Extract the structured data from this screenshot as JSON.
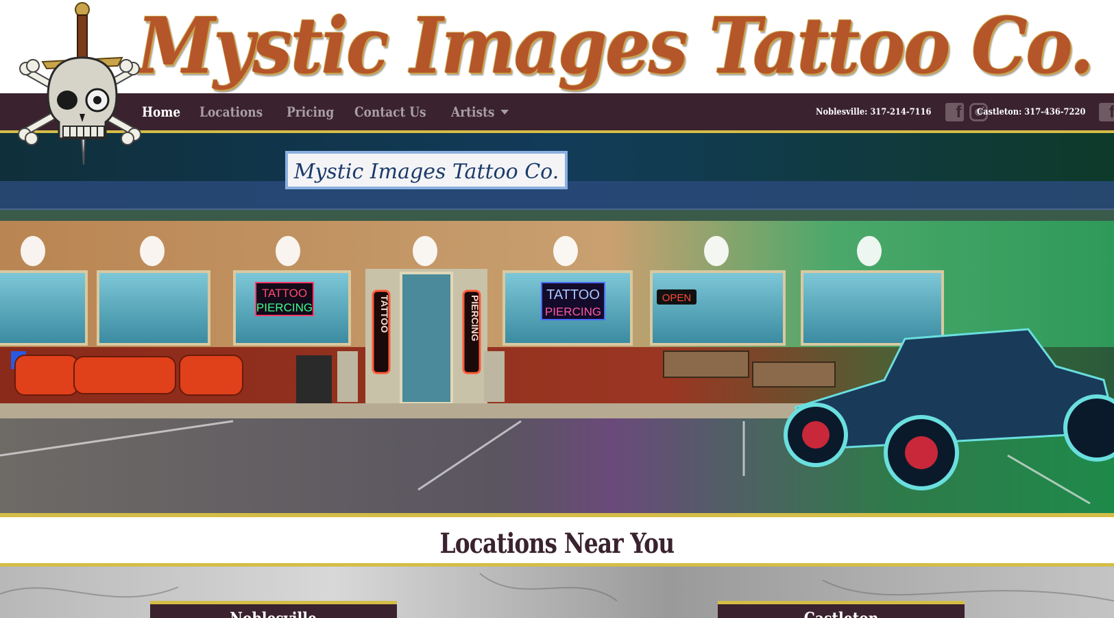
{
  "site": {
    "logo_text": "Mystic Images Tattoo Co.",
    "sign_text": "Mystic Images Tattoo Co."
  },
  "nav": {
    "items": [
      {
        "label": "Home",
        "active": true
      },
      {
        "label": "Locations",
        "active": false
      },
      {
        "label": "Pricing",
        "active": false
      },
      {
        "label": "Contact Us",
        "active": false
      },
      {
        "label": "Artists",
        "active": false,
        "dropdown": true
      }
    ],
    "contacts": [
      {
        "label": "Noblesville: 317-214-7116",
        "icons": [
          "facebook-icon",
          "instagram-icon"
        ]
      },
      {
        "label": "Castleton: 317-436-7220",
        "icons": [
          "facebook-icon",
          "instagram-icon"
        ]
      }
    ]
  },
  "hero": {
    "neon_sign_1_line1": "TATTOO",
    "neon_sign_1_line2": "PIERCING",
    "neon_sign_2_line1": "TATTOO",
    "neon_sign_2_line2": "PIERCING",
    "door_sign_left": "TATTOO",
    "door_sign_right": "PIERCING",
    "open_sign": "OPEN"
  },
  "locations": {
    "heading": "Locations Near You",
    "cards": [
      {
        "title": "Noblesville"
      },
      {
        "title": "Castleton"
      }
    ]
  },
  "colors": {
    "nav_bg": "#3a222e",
    "accent_gold": "#d4bd47",
    "nav_text": "#a99ea5",
    "nav_active": "#ffffff"
  }
}
